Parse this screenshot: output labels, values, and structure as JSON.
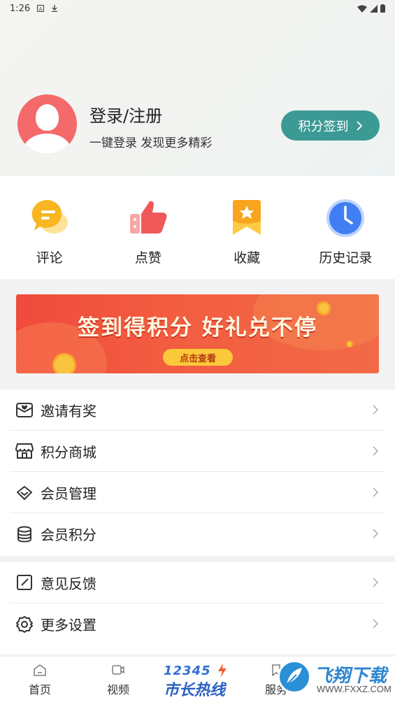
{
  "status_bar": {
    "time": "1:26"
  },
  "profile": {
    "title": "登录/注册",
    "subtitle": "一键登录 发现更多精彩",
    "signin_button": "积分签到"
  },
  "quick_actions": [
    {
      "label": "评论",
      "icon": "comment-bubble-icon"
    },
    {
      "label": "点赞",
      "icon": "thumbs-up-icon"
    },
    {
      "label": "收藏",
      "icon": "bookmark-star-icon"
    },
    {
      "label": "历史记录",
      "icon": "clock-icon"
    }
  ],
  "banner": {
    "title": "签到得积分  好礼兑不停",
    "button": "点击查看"
  },
  "menu_group_1": [
    {
      "label": "邀请有奖",
      "icon": "gift-envelope-icon"
    },
    {
      "label": "积分商城",
      "icon": "store-icon"
    },
    {
      "label": "会员管理",
      "icon": "diamond-icon"
    },
    {
      "label": "会员积分",
      "icon": "coin-stack-icon"
    }
  ],
  "menu_group_2": [
    {
      "label": "意见反馈",
      "icon": "edit-square-icon"
    },
    {
      "label": "更多设置",
      "icon": "gear-icon"
    }
  ],
  "bottom_nav": {
    "home": "首页",
    "video": "视频",
    "hotline_number": "12345",
    "hotline_text": "市长热线",
    "service": "服务"
  },
  "watermark": {
    "title": "飞翔下载",
    "url": "WWW.FXXZ.COM"
  },
  "colors": {
    "accent": "#3c9a95",
    "avatar": "#f46a6b",
    "banner": "#f04a3c"
  }
}
